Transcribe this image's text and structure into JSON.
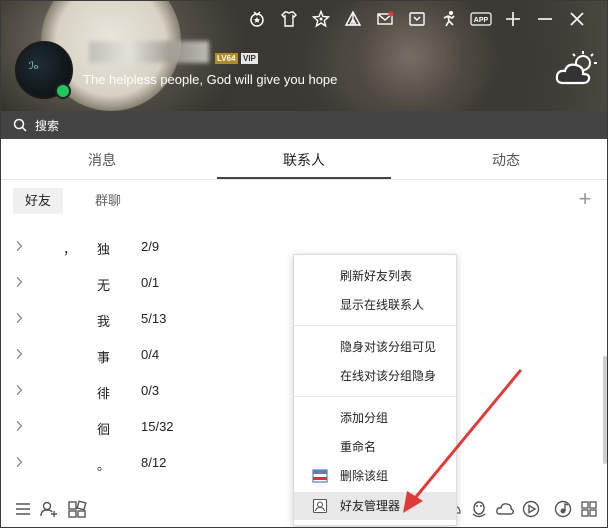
{
  "header": {
    "level_badge": "LV64",
    "vip_badge": "VIP",
    "signature": "The helpless people, God will give you hope",
    "top_icons": [
      "medal-icon",
      "shirt-icon",
      "star-icon",
      "tent-icon",
      "mail-icon",
      "tv-icon",
      "game-icon",
      "app-icon",
      "add-icon",
      "minimize-icon",
      "close-icon"
    ],
    "app_icon_text": "APP"
  },
  "search": {
    "placeholder": "搜索"
  },
  "tabs": [
    {
      "label": "消息",
      "active": false
    },
    {
      "label": "联系人",
      "active": true
    },
    {
      "label": "动态",
      "active": false
    }
  ],
  "subtabs": [
    {
      "label": "好友",
      "active": true
    },
    {
      "label": "群聊",
      "active": false
    }
  ],
  "groups": [
    {
      "prefix": "，",
      "name": "独",
      "count": "2/9"
    },
    {
      "prefix": "",
      "name": "无",
      "count": "0/1"
    },
    {
      "prefix": "",
      "name": "我",
      "count": "5/13"
    },
    {
      "prefix": "",
      "name": "事",
      "count": "0/4"
    },
    {
      "prefix": "",
      "name": "徘",
      "count": "0/3"
    },
    {
      "prefix": "",
      "name": "徊",
      "count": "15/32"
    },
    {
      "prefix": "",
      "name": "。",
      "count": "8/12"
    }
  ],
  "context_menu": {
    "items": [
      {
        "label": "刷新好友列表"
      },
      {
        "label": "显示在线联系人"
      },
      {
        "label": "隐身对该分组可见"
      },
      {
        "label": "在线对该分组隐身"
      },
      {
        "label": "添加分组"
      },
      {
        "label": "重命名"
      },
      {
        "label": "删除该组"
      },
      {
        "label": "好友管理器"
      }
    ],
    "highlighted": "好友管理器"
  },
  "colors": {
    "accent_arrow": "#e03a3a",
    "online": "#23c55e",
    "search_bg": "#444444"
  }
}
